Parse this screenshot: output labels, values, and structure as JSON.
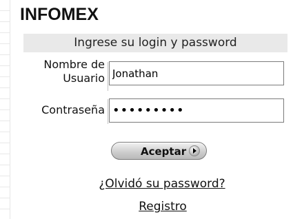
{
  "app_title": "INFOMEX",
  "form": {
    "header": "Ingrese su login y password",
    "username_label_line1": "Nombre de",
    "username_label_line2": "Usuario",
    "username_value": "Jonathan",
    "password_label": "Contraseña",
    "password_value": "jonathan1",
    "submit_label": "Aceptar"
  },
  "links": {
    "forgot_password": "¿Olvidó su password?",
    "register": "Registro"
  }
}
